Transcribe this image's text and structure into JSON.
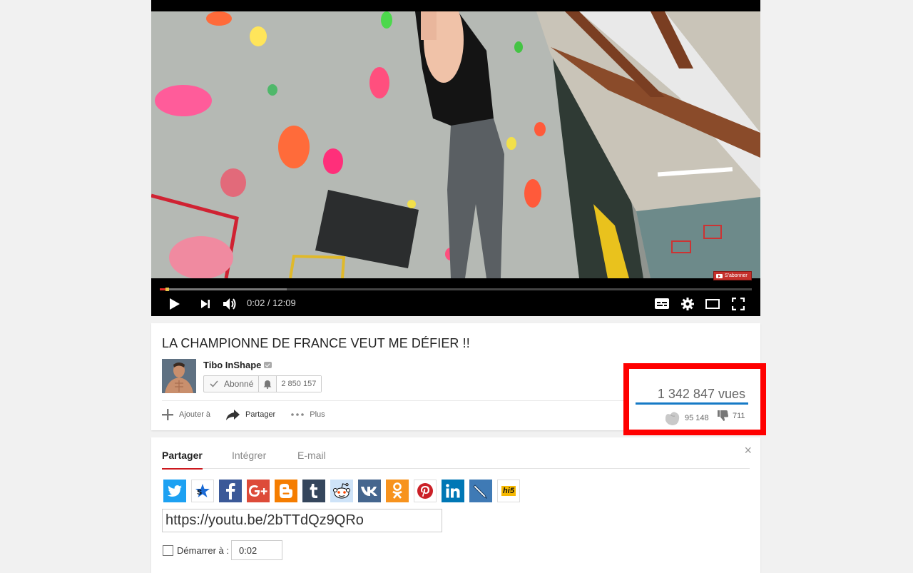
{
  "player": {
    "current_time": "0:02",
    "duration": "12:09",
    "time_display": "0:02 / 12:09",
    "progress_fraction": 0.003,
    "watermark_label": "S'abonner",
    "icons": [
      "play-icon",
      "next-icon",
      "volume-icon",
      "subtitles-icon",
      "settings-icon",
      "theater-mode-icon",
      "fullscreen-icon"
    ]
  },
  "video": {
    "title": "LA CHAMPIONNE DE FRANCE VEUT ME DÉFIER !!",
    "channel": "Tibo InShape",
    "subscribe_label": "Abonné",
    "subscriber_count": "2 850 157",
    "views": "1 342 847 vues",
    "likes": "95 148",
    "dislikes": "711",
    "like_fraction": 0.993
  },
  "actions": {
    "add": "Ajouter à",
    "share": "Partager",
    "more": "Plus"
  },
  "share_panel": {
    "tabs": [
      "Partager",
      "Intégrer",
      "E-mail"
    ],
    "active_tab": "Partager",
    "close": "×",
    "social_icons": [
      "twitter-icon",
      "stumbleupon-icon",
      "facebook-icon",
      "google-plus-icon",
      "blogger-icon",
      "tumblr-icon",
      "reddit-icon",
      "vk-icon",
      "odnoklassniki-icon",
      "pinterest-icon",
      "linkedin-icon",
      "livejournal-icon",
      "hi5-icon"
    ],
    "url": "https://youtu.be/2bTTdQz9QRo",
    "start_label": "Démarrer à :",
    "start_time": "0:02",
    "hi5_label": "hi5"
  },
  "colors": {
    "accent_red": "#cc181e",
    "highlight_red": "#ff0000",
    "sentiment_blue": "#167ac6"
  }
}
